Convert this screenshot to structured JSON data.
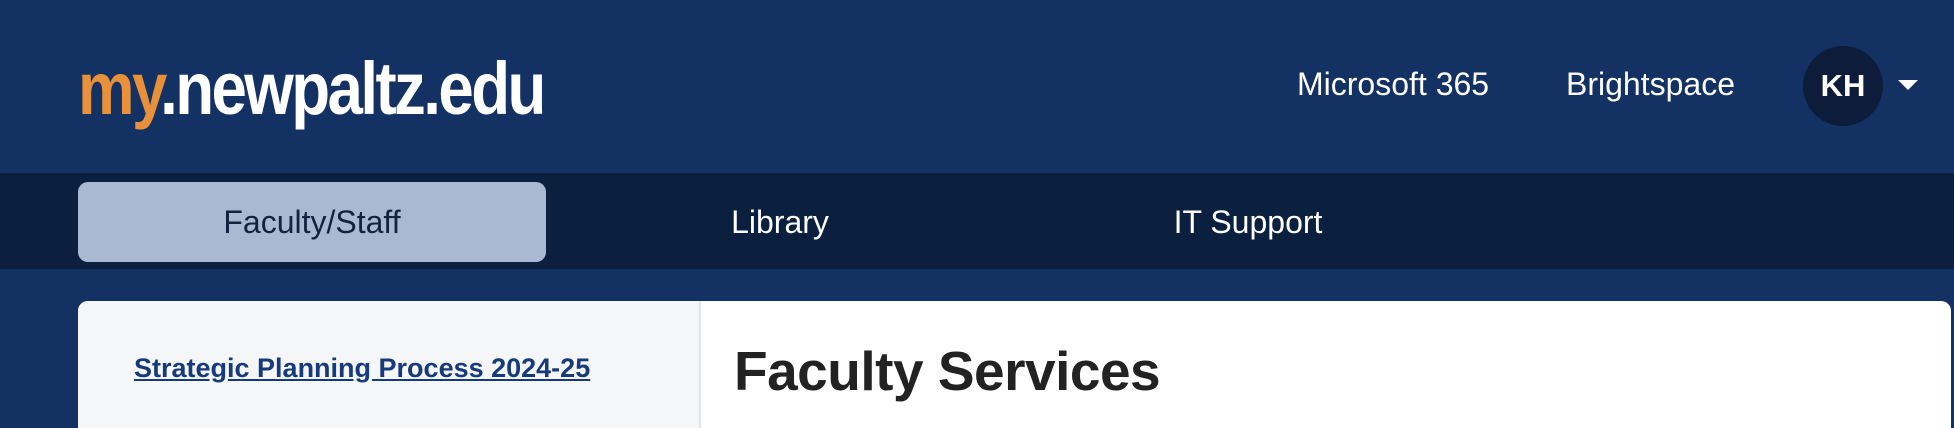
{
  "header": {
    "logo": {
      "part1": "my",
      "part2": ".newpaltz.edu"
    },
    "links": [
      "Microsoft 365",
      "Brightspace"
    ],
    "user": {
      "initials": "KH",
      "menu_icon": "caret-down-icon"
    }
  },
  "nav": {
    "tabs": [
      {
        "label": "Faculty/Staff",
        "active": true
      },
      {
        "label": "Library",
        "active": false
      },
      {
        "label": "IT Support",
        "active": false
      }
    ]
  },
  "sidebar": {
    "links": [
      "Strategic Planning Process 2024-25"
    ]
  },
  "main": {
    "title": "Faculty Services"
  },
  "colors": {
    "header_bg": "#133263",
    "nav_bg": "#0b1f3f",
    "active_tab_bg": "#a9b9d1",
    "logo_accent": "#e8913a",
    "link": "#173b7a"
  }
}
